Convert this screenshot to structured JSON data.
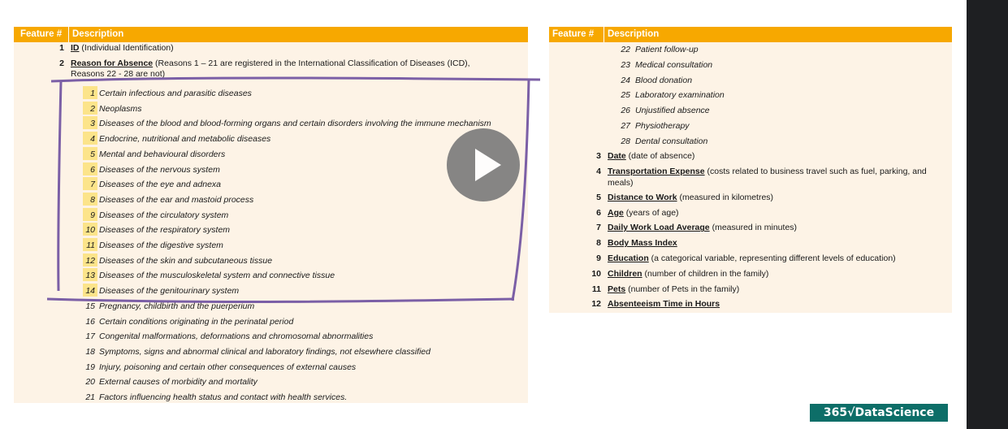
{
  "left_table": {
    "header": {
      "feature": "Feature #",
      "description": "Description"
    },
    "rows": [
      {
        "num": "1",
        "title": "ID",
        "rest": " (Individual Identification)"
      },
      {
        "num": "2",
        "title": "Reason for Absence",
        "rest": " (Reasons 1 – 21 are registered in the International Classification of Diseases (ICD),",
        "line2": "Reasons 22 - 28 are not)"
      }
    ],
    "reasons": [
      {
        "num": "1",
        "text": "Certain infectious and parasitic diseases"
      },
      {
        "num": "2",
        "text": "Neoplasms"
      },
      {
        "num": "3",
        "text": "Diseases of the blood and blood-forming organs and certain disorders involving the immune mechanism"
      },
      {
        "num": "4",
        "text": "Endocrine, nutritional and metabolic diseases"
      },
      {
        "num": "5",
        "text": "Mental and behavioural disorders"
      },
      {
        "num": "6",
        "text": "Diseases of the nervous system"
      },
      {
        "num": "7",
        "text": "Diseases of the eye and adnexa"
      },
      {
        "num": "8",
        "text": "Diseases of the ear and mastoid process"
      },
      {
        "num": "9",
        "text": "Diseases of the circulatory system"
      },
      {
        "num": "10",
        "text": "Diseases of the respiratory system"
      },
      {
        "num": "11",
        "text": "Diseases of the digestive system"
      },
      {
        "num": "12",
        "text": "Diseases of the skin and subcutaneous tissue"
      },
      {
        "num": "13",
        "text": "Diseases of the musculoskeletal system and connective tissue"
      },
      {
        "num": "14",
        "text": "Diseases of the genitourinary system"
      },
      {
        "num": "15",
        "text": "Pregnancy, childbirth and the puerperium"
      },
      {
        "num": "16",
        "text": "Certain conditions originating in the perinatal period"
      },
      {
        "num": "17",
        "text": "Congenital malformations, deformations and chromosomal abnormalities"
      },
      {
        "num": "18",
        "text": "Symptoms, signs and abnormal clinical and laboratory findings, not elsewhere classified"
      },
      {
        "num": "19",
        "text": "Injury, poisoning and certain other consequences of external causes"
      },
      {
        "num": "20",
        "text": "External causes of morbidity and mortality"
      },
      {
        "num": "21",
        "text": "Factors influencing health status and contact with health services."
      }
    ]
  },
  "right_table": {
    "header": {
      "feature": "Feature #",
      "description": "Description"
    },
    "reasons": [
      {
        "num": "22",
        "text": "Patient follow-up"
      },
      {
        "num": "23",
        "text": "Medical consultation"
      },
      {
        "num": "24",
        "text": "Blood donation"
      },
      {
        "num": "25",
        "text": "Laboratory examination"
      },
      {
        "num": "26",
        "text": "Unjustified absence"
      },
      {
        "num": "27",
        "text": "Physiotherapy"
      },
      {
        "num": "28",
        "text": "Dental consultation"
      }
    ],
    "features": [
      {
        "num": "3",
        "title": "Date",
        "rest": " (date of absence)"
      },
      {
        "num": "4",
        "title": "Transportation Expense",
        "rest": " (costs related to business travel such as fuel, parking, and",
        "line2": "meals)"
      },
      {
        "num": "5",
        "title": "Distance to Work",
        "rest": " (measured in kilometres)"
      },
      {
        "num": "6",
        "title": "Age",
        "rest": " (years of age)"
      },
      {
        "num": "7",
        "title": "Daily Work Load Average",
        "rest": " (measured in minutes)"
      },
      {
        "num": "8",
        "title": "Body Mass Index",
        "rest": ""
      },
      {
        "num": "9",
        "title": "Education",
        "rest": " (a categorical variable, representing different levels of education)"
      },
      {
        "num": "10",
        "title": "Children",
        "rest": " (number of children in the family)"
      },
      {
        "num": "11",
        "title": "Pets",
        "rest": " (number of Pets in the family)"
      },
      {
        "num": "12",
        "title": "Absenteeism Time in Hours",
        "rest": ""
      }
    ]
  },
  "video": {
    "play_icon": "play-icon"
  },
  "logo": {
    "text": "365√DataScience",
    "colour": "#0d6e68"
  },
  "colors": {
    "header": "#f7a800",
    "table_bg": "#fdf3e6",
    "highlight": "#fce48a",
    "annotation": "#7b5fa6"
  }
}
